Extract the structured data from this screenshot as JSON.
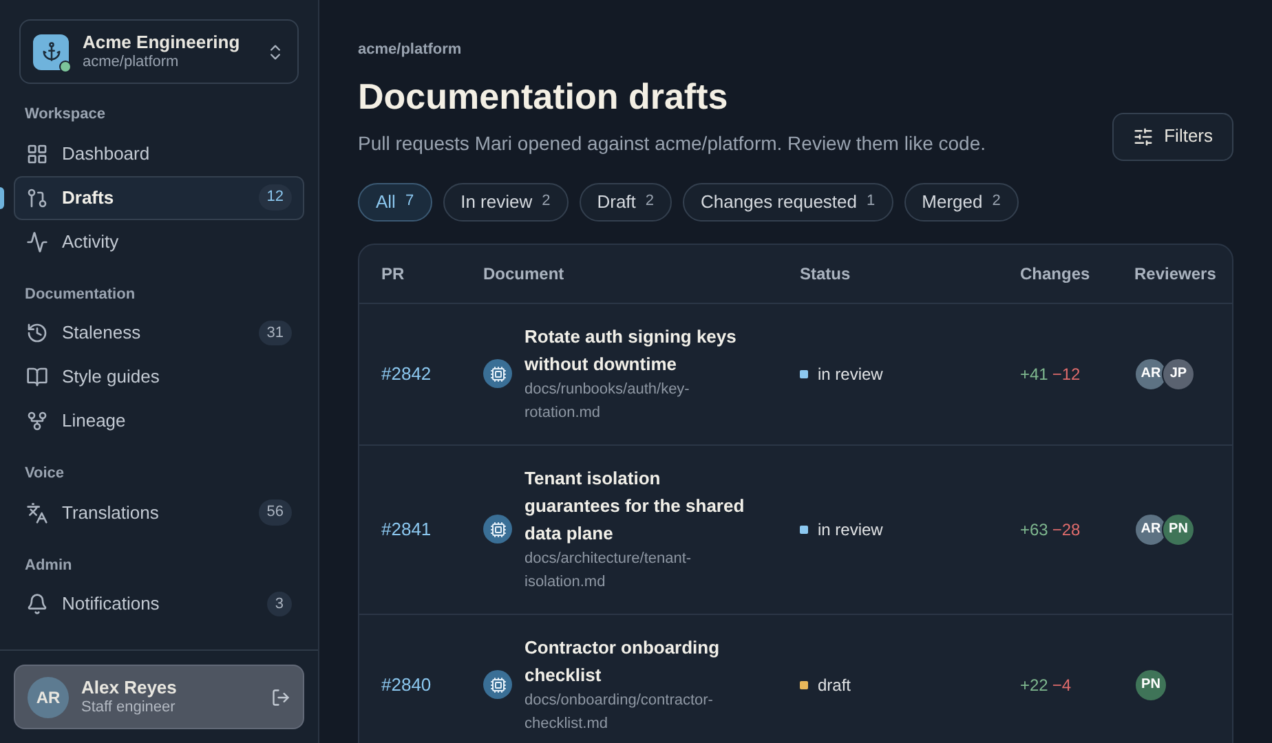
{
  "org": {
    "name": "Acme Engineering",
    "repo": "acme/platform",
    "online": true
  },
  "nav": [
    {
      "heading": "Workspace",
      "items": [
        {
          "label": "Dashboard",
          "kind": "grid",
          "selected": false
        },
        {
          "label": "Drafts",
          "kind": "pr",
          "count": "12",
          "selected": true
        },
        {
          "label": "Activity",
          "kind": "pulse",
          "selected": false
        }
      ]
    },
    {
      "heading": "Documentation",
      "items": [
        {
          "label": "Staleness",
          "kind": "history",
          "count": "31",
          "selected": false
        },
        {
          "label": "Style guides",
          "kind": "book",
          "selected": false
        },
        {
          "label": "Lineage",
          "kind": "fork",
          "selected": false
        }
      ]
    },
    {
      "heading": "Voice",
      "items": [
        {
          "label": "Translations",
          "kind": "lang",
          "count": "56",
          "selected": false
        }
      ]
    },
    {
      "heading": "Admin",
      "items": [
        {
          "label": "Notifications",
          "kind": "bell",
          "count": "3",
          "selected": false
        }
      ]
    }
  ],
  "user": {
    "initials": "AR",
    "name": "Alex Reyes",
    "role": "Staff engineer"
  },
  "breadcrumb": "acme/platform",
  "title": "Documentation drafts",
  "subtitle": "Pull requests Mari opened against acme/platform. Review them like code.",
  "filters_button": "Filters",
  "chips": [
    {
      "label": "All",
      "count": "7",
      "selected": true
    },
    {
      "label": "In review",
      "count": "2",
      "selected": false
    },
    {
      "label": "Draft",
      "count": "2",
      "selected": false
    },
    {
      "label": "Changes requested",
      "count": "1",
      "selected": false
    },
    {
      "label": "Merged",
      "count": "2",
      "selected": false
    }
  ],
  "table": {
    "columns": [
      "PR",
      "Document",
      "Status",
      "Changes",
      "Reviewers"
    ],
    "rows": [
      {
        "pr": "#2842",
        "title": "Rotate auth signing keys without downtime",
        "path": "docs/runbooks/auth/key-rotation.md",
        "status": "in review",
        "color": "#8cc8f0",
        "added": "+41",
        "removed": "−12",
        "reviewers": [
          {
            "initials": "AR",
            "color": "#5d7283"
          },
          {
            "initials": "JP",
            "color": "#5a6270"
          }
        ]
      },
      {
        "pr": "#2841",
        "title": "Tenant isolation guarantees for the shared data plane",
        "path": "docs/architecture/tenant-isolation.md",
        "status": "in review",
        "color": "#8cc8f0",
        "added": "+63",
        "removed": "−28",
        "reviewers": [
          {
            "initials": "AR",
            "color": "#5d7283"
          },
          {
            "initials": "PN",
            "color": "#3f7458"
          }
        ]
      },
      {
        "pr": "#2840",
        "title": "Contractor onboarding checklist",
        "path": "docs/onboarding/contractor-checklist.md",
        "status": "draft",
        "color": "#e8b75a",
        "added": "+22",
        "removed": "−4",
        "reviewers": [
          {
            "initials": "PN",
            "color": "#3f7458"
          }
        ]
      }
    ]
  }
}
